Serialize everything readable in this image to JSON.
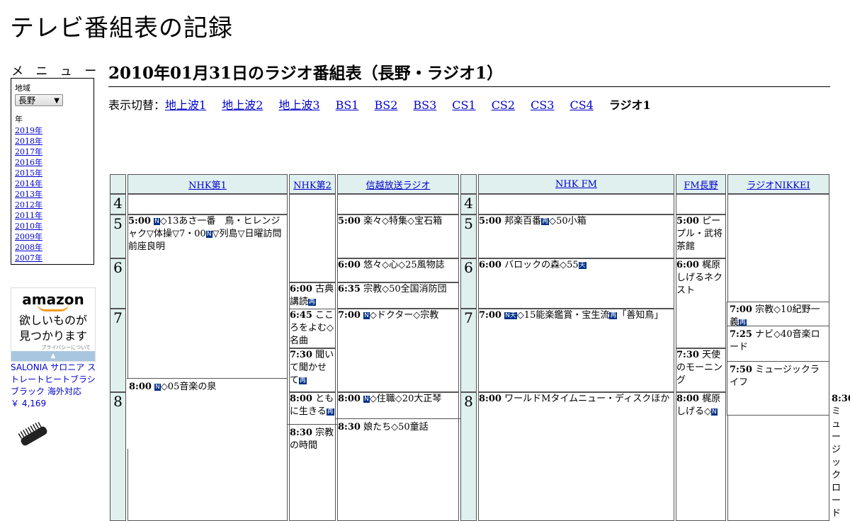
{
  "site": {
    "title": "テレビ番組表の記録"
  },
  "menu": {
    "heading": "メ ニ ュ ー",
    "region_label": "地域",
    "region_value": "長野",
    "year_label": "年",
    "years": [
      "2019年",
      "2018年",
      "2017年",
      "2016年",
      "2015年",
      "2014年",
      "2013年",
      "2012年",
      "2011年",
      "2010年",
      "2009年",
      "2008年",
      "2007年"
    ]
  },
  "ad": {
    "logo": "amazon",
    "message_1": "欲しいものが",
    "message_2": "見つかります",
    "privacy": "プライバシーについて",
    "product": "SALONIA サロニア ストレートヒートブラシ ブラック 海外対応",
    "price": "￥ 4,169"
  },
  "page": {
    "heading": "2010年01月31日のラジオ番組表（長野・ラジオ1）"
  },
  "switcher": {
    "label": "表示切替：",
    "links": [
      "地上波1",
      "地上波2",
      "地上波3",
      "BS1",
      "BS2",
      "BS3",
      "CS1",
      "CS2",
      "CS3",
      "CS4"
    ],
    "current": "ラジオ1"
  },
  "channels": [
    "NHK第1",
    "NHK第2",
    "信越放送ラジオ",
    "NHK FM",
    "FM長野",
    "ラジオNIKKEI"
  ],
  "hours": [
    "4",
    "5",
    "6",
    "7",
    "8"
  ],
  "programs": {
    "nhk1_500": {
      "time": "5:00",
      "icon": "N",
      "text": "◇13あさ一番　鳥・ヒレンジャク▽体操▽7・00",
      "icon2": "N",
      "text2": "▽列島▽日曜訪問　前座良明"
    },
    "nhk1_800": {
      "time": "8:00",
      "icon": "N",
      "text": "◇05音楽の泉"
    },
    "nhk2_600": {
      "time": "6:00",
      "text": "古典講読",
      "icon": "再"
    },
    "nhk2_645": {
      "time": "6:45",
      "text": "こころをよむ◇名曲"
    },
    "nhk2_730": {
      "time": "7:30",
      "text": "聞いて聞かせて",
      "icon": "再"
    },
    "nhk2_800": {
      "time": "8:00",
      "text": "ともに生きる",
      "icon": "再"
    },
    "nhk2_830": {
      "time": "8:30",
      "text": "宗教の時間"
    },
    "sbc_500": {
      "time": "5:00",
      "text": "楽々◇特集◇宝石箱"
    },
    "sbc_600": {
      "time": "6:00",
      "text": "悠々◇心◇25風物誌"
    },
    "sbc_635": {
      "time": "6:35",
      "text": "宗教◇50全国消防団"
    },
    "sbc_700": {
      "time": "7:00",
      "icon": "N",
      "text": "◇ドクター◇宗教"
    },
    "sbc_800": {
      "time": "8:00",
      "icon": "N",
      "text": "◇住職◇20大正琴"
    },
    "sbc_830": {
      "time": "8:30",
      "text": "娘たち◇50童話"
    },
    "fm_500": {
      "time": "5:00",
      "text": "邦楽百番",
      "icon": "再",
      "text2": "◇50小箱"
    },
    "fm_600": {
      "time": "6:00",
      "text": "バロックの森◇55",
      "icon": "天"
    },
    "fm_700": {
      "time": "7:00",
      "icon": "N天",
      "text": "◇15能楽鑑賞・宝生流",
      "icon2": "再",
      "text2": "「善知鳥」"
    },
    "fm_800": {
      "time": "8:00",
      "text": "ワールドMタイムニュー・ディスクほか"
    },
    "fmn_500": {
      "time": "5:00",
      "text": "ピープル・武将茶館"
    },
    "fmn_600": {
      "time": "6:00",
      "text": "梶原しげるネクスト"
    },
    "fmn_730": {
      "time": "7:30",
      "text": "天使のモーニング"
    },
    "fmn_800": {
      "time": "8:00",
      "text": "梶原しげる◇",
      "icon": "N"
    },
    "nk_700": {
      "time": "7:00",
      "text": "宗教◇10紀野一義",
      "icon": "再"
    },
    "nk_725": {
      "time": "7:25",
      "text": "ナビ◇40音楽ロード"
    },
    "nk_750": {
      "time": "7:50",
      "text": "ミュージックライフ"
    },
    "nk_830": {
      "time": "8:30",
      "text": "ミュージックロード"
    }
  },
  "colors": {
    "header_bg": "#dff0ef",
    "link": "#0000cc",
    "icon_bg": "#00318a"
  }
}
